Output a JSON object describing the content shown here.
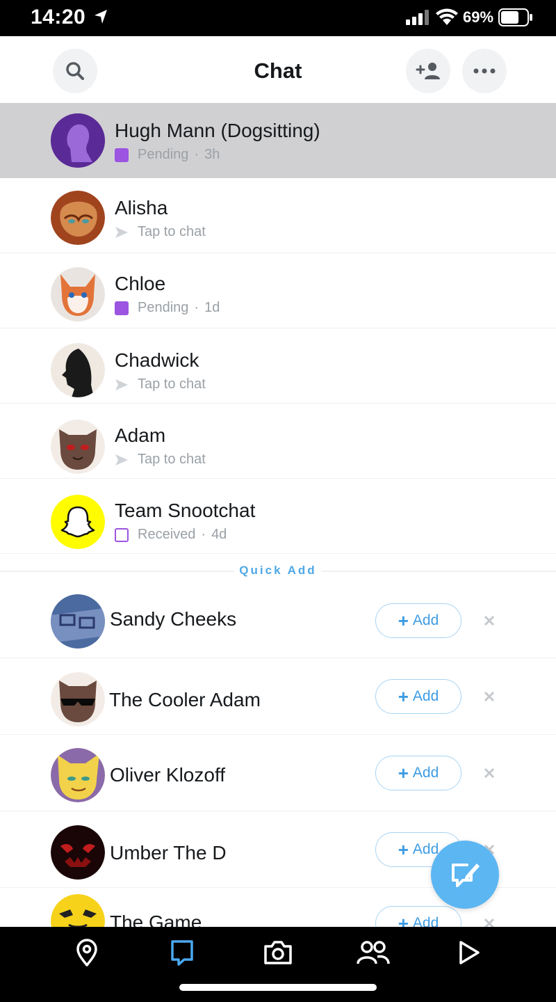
{
  "status_bar": {
    "time": "14:20",
    "battery": "69%"
  },
  "header": {
    "title": "Chat"
  },
  "chats": [
    {
      "name": "Hugh Mann (Dogsitting)",
      "status": "Pending",
      "time": "3h",
      "status_icon": "filled-purple-square",
      "highlighted": true
    },
    {
      "name": "Alisha",
      "status": "Tap to chat",
      "time": "",
      "status_icon": "gray-arrow"
    },
    {
      "name": "Chloe",
      "status": "Pending",
      "time": "1d",
      "status_icon": "filled-purple-square"
    },
    {
      "name": "Chadwick",
      "status": "Tap to chat",
      "time": "",
      "status_icon": "gray-arrow"
    },
    {
      "name": "Adam",
      "status": "Tap to chat",
      "time": "",
      "status_icon": "gray-arrow"
    },
    {
      "name": "Team Snootchat",
      "status": "Received",
      "time": "4d",
      "status_icon": "outline-purple-square"
    }
  ],
  "quick_add": {
    "label": "Quick Add",
    "add_label": "Add",
    "items": [
      {
        "name": "Sandy Cheeks"
      },
      {
        "name": "The Cooler Adam"
      },
      {
        "name": "Oliver Klozoff"
      },
      {
        "name": "Umber The D"
      },
      {
        "name": "The Game"
      }
    ]
  },
  "colors": {
    "accent_blue": "#3d9ce3",
    "pending_purple": "#9b55e0",
    "fab_blue": "#5cb6f2",
    "highlight_row": "#d0d0d2"
  },
  "tabs": [
    "map-pin-icon",
    "chat-icon",
    "camera-icon",
    "friends-icon",
    "play-icon"
  ],
  "active_tab": "chat-icon"
}
